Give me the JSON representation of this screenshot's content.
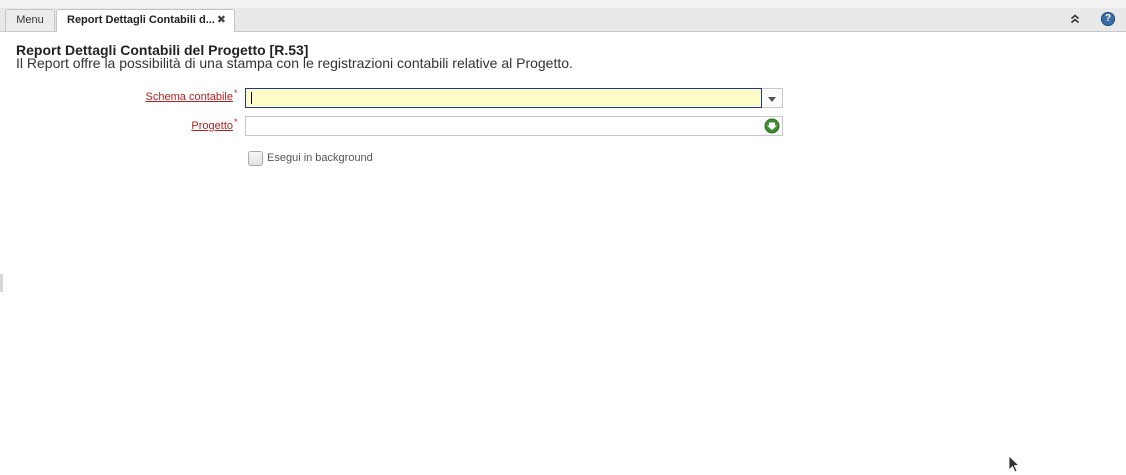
{
  "tabs": {
    "menu_label": "Menu",
    "active_label": "Report Dettagli Contabili d...",
    "close_glyph": "✖"
  },
  "header": {
    "collapse_icon": "double-chevron-up-icon",
    "help_icon": "help-icon",
    "help_glyph": "?"
  },
  "page": {
    "title": "Report Dettagli Contabili del Progetto [R.53]",
    "description": "Il Report offre la possibilità di una stampa con le registrazioni contabili relative al Progetto."
  },
  "form": {
    "schema": {
      "label": "Schema contabile",
      "required_mark": "*",
      "value": ""
    },
    "progetto": {
      "label": "Progetto",
      "required_mark": "*",
      "value": "",
      "icon": "search-arrow-icon"
    },
    "background": {
      "label": "Esegui in background",
      "checked": false
    }
  },
  "colors": {
    "required_label": "#b22222",
    "focused_field_bg": "#fdfbc8",
    "focused_field_border": "#1d3b8b",
    "help_icon": "#3a6ea5",
    "search_icon": "#3e8e2f"
  }
}
